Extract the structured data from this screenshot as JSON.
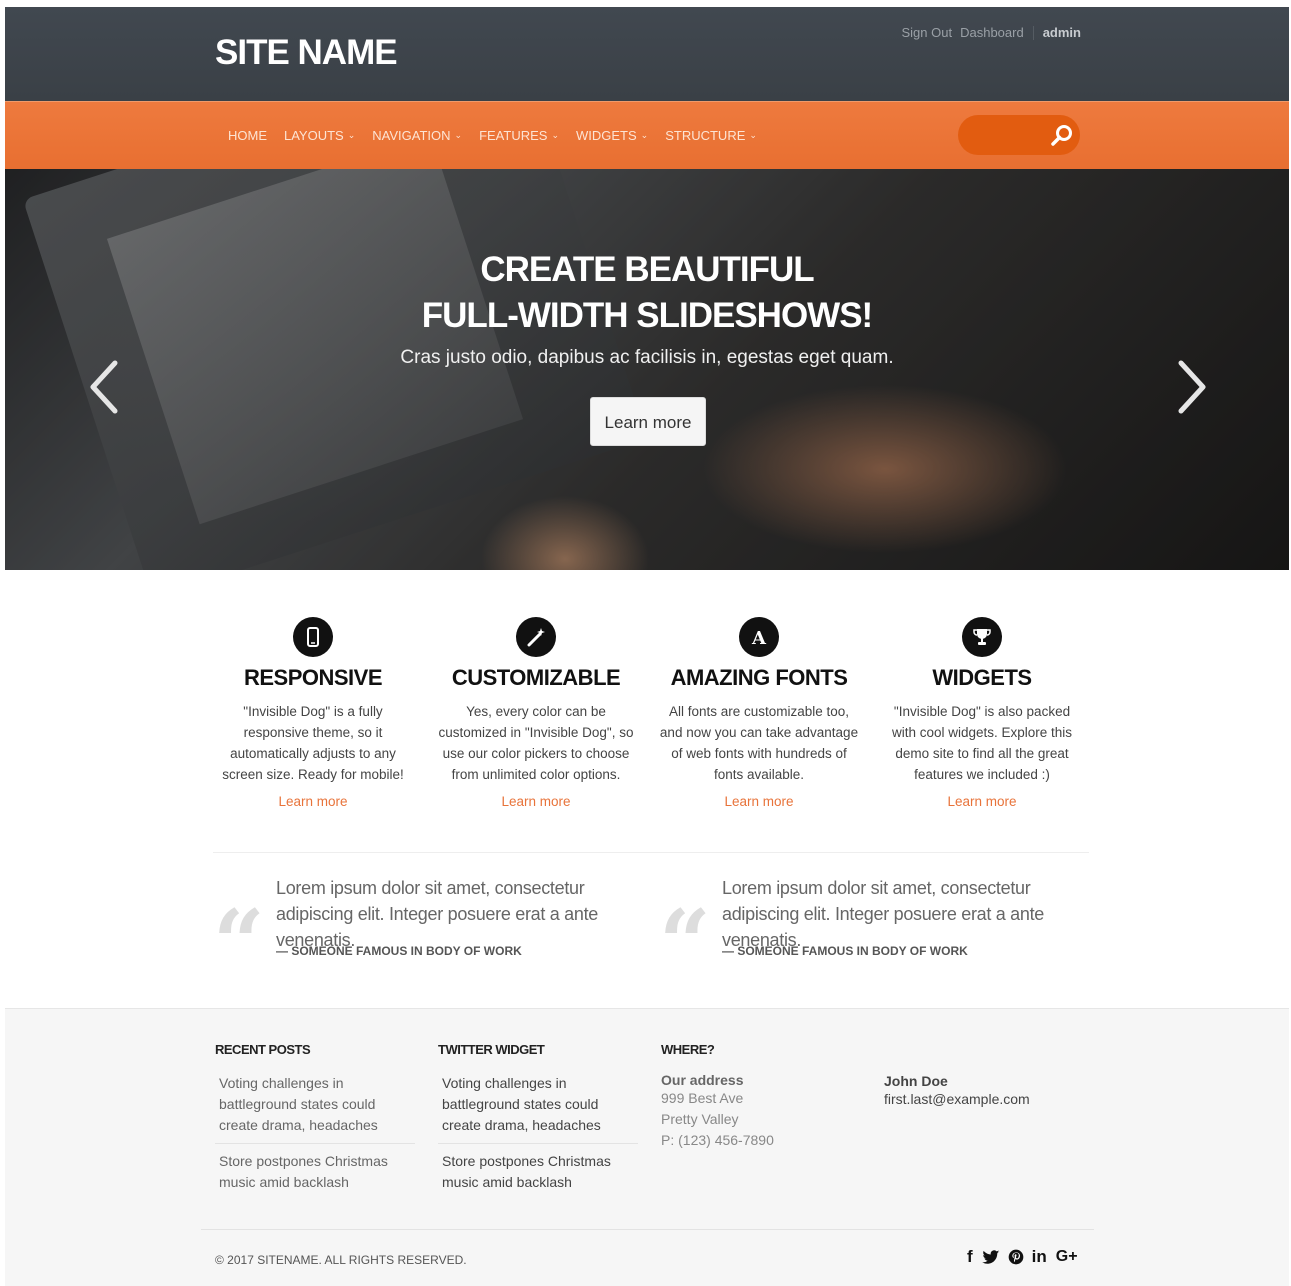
{
  "header": {
    "site_name": "SITE NAME",
    "links": {
      "sign_out": "Sign Out",
      "dashboard": "Dashboard",
      "admin": "admin"
    }
  },
  "nav": {
    "items": [
      {
        "label": "HOME",
        "dropdown": false
      },
      {
        "label": "LAYOUTS",
        "dropdown": true
      },
      {
        "label": "NAVIGATION",
        "dropdown": true
      },
      {
        "label": "FEATURES",
        "dropdown": true
      },
      {
        "label": "WIDGETS",
        "dropdown": true
      },
      {
        "label": "STRUCTURE",
        "dropdown": true
      }
    ],
    "chevron": "⌄",
    "search": {
      "value": "",
      "icon": "search-icon"
    }
  },
  "hero": {
    "title_line1": "CREATE BEAUTIFUL",
    "title_line2": "FULL-WIDTH SLIDESHOWS!",
    "subtitle": "Cras justo odio, dapibus ac facilisis in, egestas eget quam.",
    "button": "Learn more"
  },
  "features": [
    {
      "icon": "mobile-icon",
      "title": "RESPONSIVE",
      "text": "\"Invisible Dog\" is a fully responsive theme, so it automatically adjusts to any screen size. Ready for mobile!",
      "link": "Learn more"
    },
    {
      "icon": "magic-wand-icon",
      "title": "CUSTOMIZABLE",
      "text": "Yes, every color can be customized in \"Invisible Dog\", so use our color pickers to choose from unlimited color options.",
      "link": "Learn more"
    },
    {
      "icon": "font-icon",
      "title": "AMAZING FONTS",
      "text": "All fonts are customizable too, and now you can take advantage of web fonts with hundreds of fonts available.",
      "link": "Learn more"
    },
    {
      "icon": "trophy-icon",
      "title": "WIDGETS",
      "text": "\"Invisible Dog\" is also packed with cool widgets. Explore this demo site to find all the great features we included :)",
      "link": "Learn more"
    }
  ],
  "quotes": [
    {
      "text": "Lorem ipsum dolor sit amet, consectetur adipiscing elit. Integer posuere erat a ante venenatis.",
      "source": "— SOMEONE FAMOUS IN BODY OF WORK"
    },
    {
      "text": "Lorem ipsum dolor sit amet, consectetur adipiscing elit. Integer posuere erat a ante venenatis.",
      "source": "— SOMEONE FAMOUS IN BODY OF WORK"
    }
  ],
  "footer": {
    "recent_posts": {
      "heading": "RECENT POSTS",
      "posts": [
        "Voting challenges in battleground states could create drama, headaches",
        "Store postpones Christmas music amid backlash"
      ]
    },
    "twitter": {
      "heading": "TWITTER WIDGET",
      "posts": [
        "Voting challenges in battleground states could create drama, headaches",
        "Store postpones Christmas music amid backlash"
      ]
    },
    "where": {
      "heading": "WHERE?",
      "address_title": "Our address",
      "street": "999 Best Ave",
      "city": "Pretty Valley",
      "phone": "P: (123) 456-7890"
    },
    "contact": {
      "name": "John Doe",
      "email": "first.last@example.com"
    },
    "copyright": "© 2017 SITENAME. ALL RIGHTS RESERVED.",
    "social": [
      "f",
      "🐦",
      "℗",
      "in",
      "G+"
    ]
  },
  "colors": {
    "accent": "#e8733a",
    "header_bg": "#3d4349",
    "nav_bg": "#eb7535",
    "footer_bg": "#f6f6f6"
  }
}
